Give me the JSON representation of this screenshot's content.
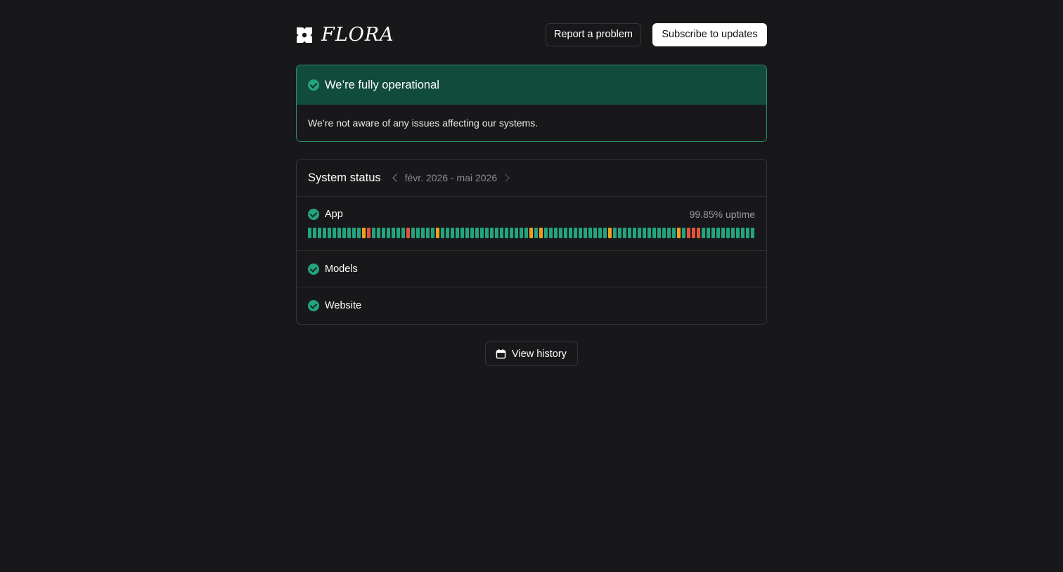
{
  "brand": {
    "name": "FLORA"
  },
  "header": {
    "report_label": "Report a problem",
    "subscribe_label": "Subscribe to updates"
  },
  "banner": {
    "title": "We’re fully operational",
    "message": "We’re not aware of any issues affecting our systems."
  },
  "status": {
    "title": "System status",
    "range": "févr. 2026 - mai 2026",
    "components": [
      {
        "name": "App",
        "uptime": "99.85% uptime"
      },
      {
        "name": "Models"
      },
      {
        "name": "Website"
      }
    ],
    "app_history": [
      "ok",
      "ok",
      "ok",
      "ok",
      "ok",
      "ok",
      "ok",
      "ok",
      "ok",
      "ok",
      "ok",
      "minor",
      "major",
      "ok",
      "ok",
      "ok",
      "ok",
      "ok",
      "ok",
      "ok",
      "major",
      "ok",
      "ok",
      "ok",
      "ok",
      "ok",
      "minor",
      "ok",
      "ok",
      "ok",
      "ok",
      "ok",
      "ok",
      "ok",
      "ok",
      "ok",
      "ok",
      "ok",
      "ok",
      "ok",
      "ok",
      "ok",
      "ok",
      "ok",
      "ok",
      "minor",
      "ok",
      "minor",
      "ok",
      "ok",
      "ok",
      "ok",
      "ok",
      "ok",
      "ok",
      "ok",
      "ok",
      "ok",
      "ok",
      "ok",
      "ok",
      "minor",
      "ok",
      "ok",
      "ok",
      "ok",
      "ok",
      "ok",
      "ok",
      "ok",
      "ok",
      "ok",
      "ok",
      "ok",
      "ok",
      "minor",
      "ok",
      "major",
      "major",
      "major",
      "ok",
      "ok",
      "ok",
      "ok",
      "ok",
      "ok",
      "ok",
      "ok",
      "ok",
      "ok",
      "ok"
    ]
  },
  "colors": {
    "ok": "#23a47e",
    "minor": "#f0a020",
    "major": "#e5533d"
  },
  "history_label": "View history"
}
